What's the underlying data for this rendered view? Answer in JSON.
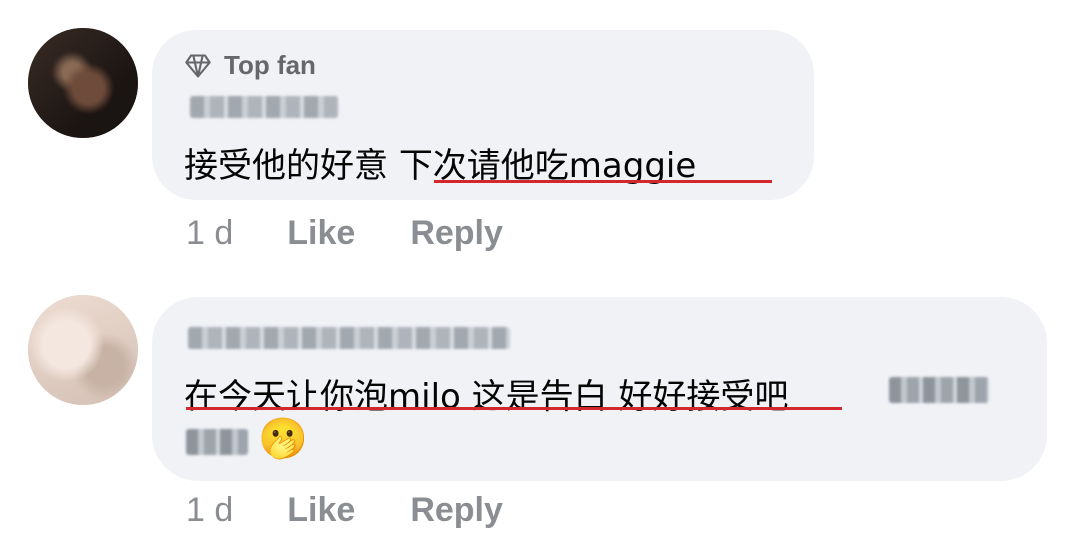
{
  "comments": [
    {
      "badge": "Top fan",
      "badge_icon": "diamond-icon",
      "author": "",
      "text_plain": "接受他的好意 ",
      "text_highlight": "下次请他吃maggie",
      "time": "1 d",
      "like_label": "Like",
      "reply_label": "Reply"
    },
    {
      "author": "",
      "text_highlight": "在今天让你泡milo 这是告白 好好接受",
      "text_plain": "吧",
      "emoji": "🫢",
      "time": "1 d",
      "like_label": "Like",
      "reply_label": "Reply"
    }
  ],
  "colors": {
    "bubble": "#f0f2f5",
    "underline": "#d3262d",
    "meta_text": "#8a8d91",
    "body_text": "#050505"
  }
}
